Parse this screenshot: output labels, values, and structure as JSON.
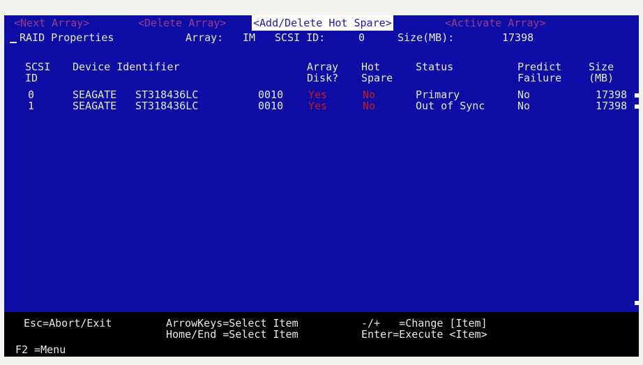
{
  "menu": {
    "next_array": "<Next Array>",
    "delete_array": "<Delete Array>",
    "add_delete_hot_spare": "<Add/Delete Hot Spare>",
    "activate_array": "<Activate Array>"
  },
  "properties": {
    "title": "RAID Properties",
    "array_label": "Array:",
    "array_value": "IM",
    "scsi_id_label": "SCSI ID:",
    "scsi_id_value": "0",
    "size_label": "Size(MB):",
    "size_value": "17398"
  },
  "columns": {
    "scsi_id_l1": "SCSI",
    "scsi_id_l2": "ID",
    "device": "Device Identifier",
    "array_disk_l1": "Array",
    "array_disk_l2": "Disk?",
    "hot_spare_l1": "Hot",
    "hot_spare_l2": "Spare",
    "status": "Status",
    "predict_l1": "Predict",
    "predict_l2": "Failure",
    "size_l1": "Size",
    "size_l2": "(MB)"
  },
  "rows": [
    {
      "id": "0",
      "vendor": "SEAGATE",
      "model": "ST318436LC",
      "rev": "0010",
      "array_disk": "Yes",
      "hot_spare": "No",
      "status": "Primary",
      "predict": "No",
      "size": "17398"
    },
    {
      "id": "1",
      "vendor": "SEAGATE",
      "model": "ST318436LC",
      "rev": "0010",
      "array_disk": "Yes",
      "hot_spare": "No",
      "status": "Out of Sync",
      "predict": "No",
      "size": "17398"
    }
  ],
  "footer": {
    "esc": "Esc=Abort/Exit",
    "arrow": "ArrowKeys=Select Item",
    "home_end": "Home/End =Select Item",
    "change": "-/+   =Change [Item]",
    "enter": "Enter=Execute <Item>",
    "f2": "F2 =Menu"
  },
  "colors": {
    "screen_bg": "#0d0da6",
    "text": "#e8e8f0",
    "dim_menu": "#9a3a8a",
    "red_value": "#c8181c",
    "footer_bg": "#000000"
  }
}
